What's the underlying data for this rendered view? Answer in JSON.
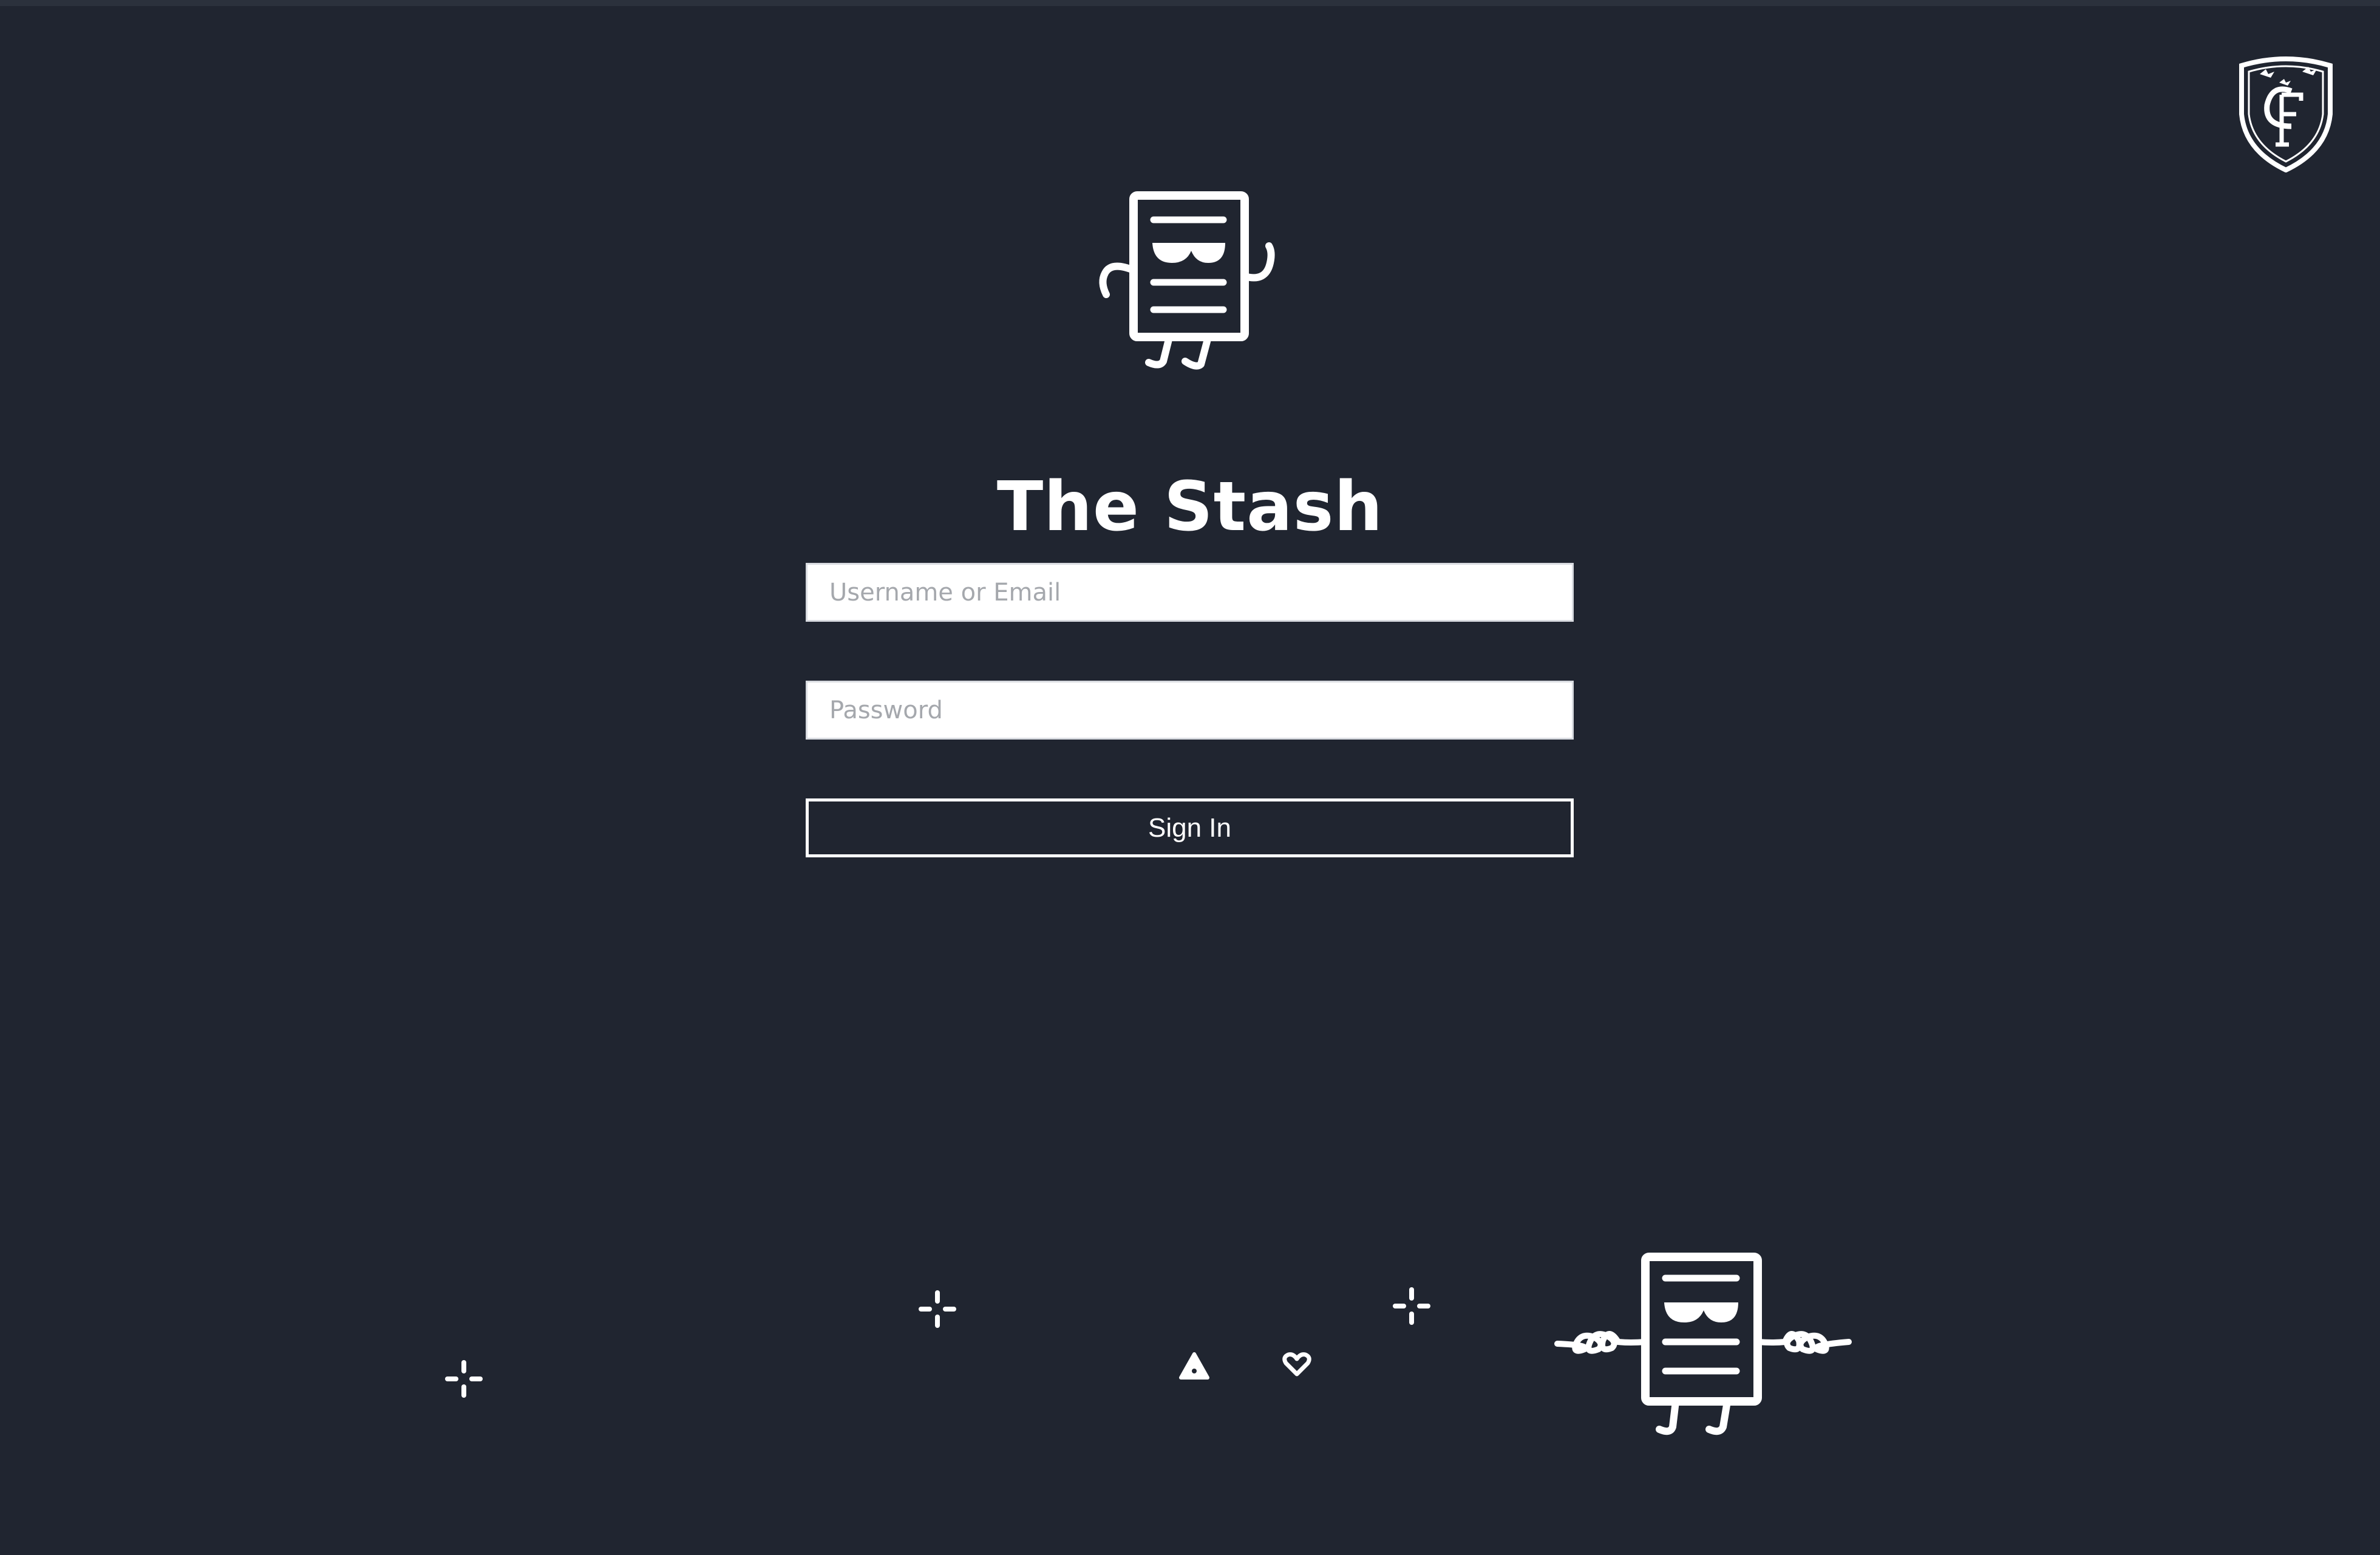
{
  "app": {
    "title": "The Stash"
  },
  "login_form": {
    "username_placeholder": "Username or Email",
    "username_value": "",
    "password_placeholder": "Password",
    "password_value": "",
    "submit_label": "Sign In"
  },
  "icons": {
    "crest": "crest-logo-icon",
    "mascot_top": "document-mascot-icon",
    "mascot_bottom": "document-mascot-waving-icon",
    "sparkle": "sparkle-icon",
    "triangle": "triangle-icon",
    "heart": "heart-icon"
  },
  "colors": {
    "background": "#202530",
    "foreground": "#ffffff",
    "input_background": "#ffffff",
    "placeholder": "#a5a8ad"
  }
}
